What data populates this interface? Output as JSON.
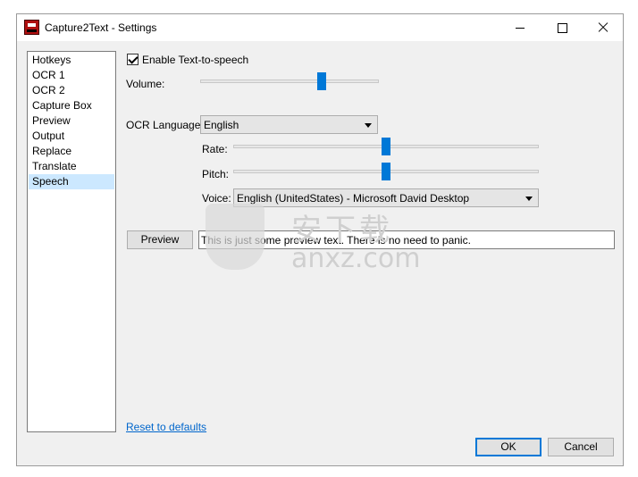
{
  "window": {
    "title": "Capture2Text - Settings"
  },
  "nav": {
    "items": [
      {
        "label": "Hotkeys"
      },
      {
        "label": "OCR 1"
      },
      {
        "label": "OCR 2"
      },
      {
        "label": "Capture Box"
      },
      {
        "label": "Preview"
      },
      {
        "label": "Output"
      },
      {
        "label": "Replace"
      },
      {
        "label": "Translate"
      },
      {
        "label": "Speech"
      }
    ],
    "selected": "Speech"
  },
  "speech": {
    "enable_label": "Enable Text-to-speech",
    "enable_checked": true,
    "volume_label": "Volume:",
    "volume_level": 0.68,
    "ocr_language_label": "OCR Language:",
    "ocr_language_value": "English",
    "rate_label": "Rate:",
    "rate_level": 0.5,
    "pitch_label": "Pitch:",
    "pitch_level": 0.5,
    "voice_label": "Voice:",
    "voice_value": "English (UnitedStates) - Microsoft David Desktop",
    "preview_button": "Preview",
    "preview_text": "This is just some preview text. There is no need to panic."
  },
  "footer": {
    "reset_link": "Reset to defaults",
    "ok_button": "OK",
    "cancel_button": "Cancel"
  },
  "watermark": {
    "cn_text": "安下载",
    "latin_text": "anxz.com"
  },
  "colors": {
    "accent": "#0078d7",
    "selection": "#cce8ff",
    "link": "#0066cc"
  }
}
